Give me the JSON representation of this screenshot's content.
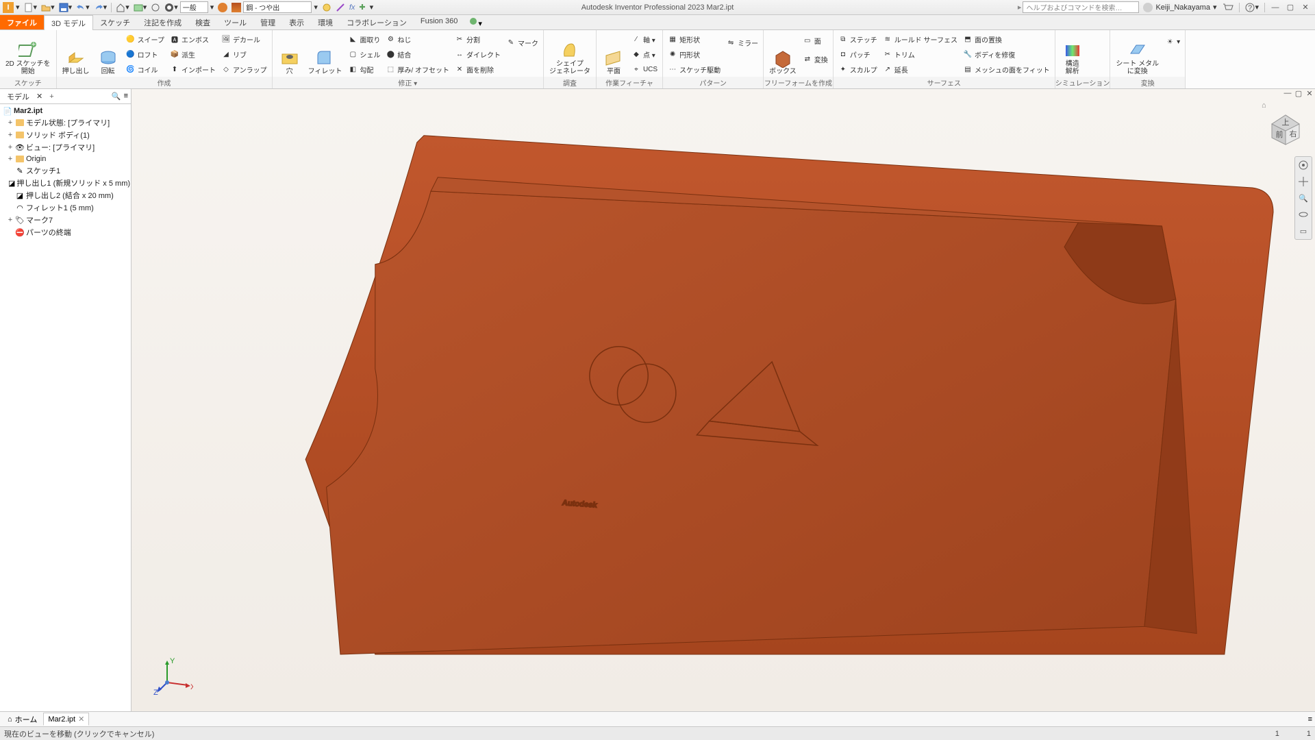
{
  "title": "Autodesk Inventor Professional 2023   Mar2.ipt",
  "search_placeholder": "ヘルプおよびコマンドを検索…",
  "user": "Keiji_Nakayama",
  "qat_generic": "一般",
  "qat_material": "鋼 - つや出",
  "tabs": {
    "file": "ファイル",
    "items": [
      "3D モデル",
      "スケッチ",
      "注記を作成",
      "検査",
      "ツール",
      "管理",
      "表示",
      "環境",
      "コラボレーション",
      "Fusion 360"
    ]
  },
  "ribbon": {
    "sketch": {
      "sketch2d": "2D スケッチを\n開始",
      "label": "スケッチ"
    },
    "create": {
      "extrude": "押し出し",
      "revolve": "回転",
      "sweep": "スイープ",
      "loft": "ロフト",
      "coil": "コイル",
      "emboss": "エンボス",
      "derive": "派生",
      "import": "インポート",
      "rib": "リブ",
      "decal": "デカール",
      "unwrap": "アンラップ",
      "label": "作成"
    },
    "modify": {
      "hole": "穴",
      "fillet": "フィレット",
      "chamfer": "面取り",
      "shell": "シェル",
      "draft": "勾配",
      "split": "分割",
      "combine": "結合",
      "thicken": "厚み/ オフセット",
      "thread": "ねじ",
      "direct": "ダイレクト",
      "deleteface": "面を削除",
      "mark": "マーク",
      "label": "修正 ▾"
    },
    "shape": {
      "gen": "シェイプ\nジェネレータ",
      "label": "調査"
    },
    "workfeat": {
      "plane": "平面",
      "axis": "軸 ▾",
      "point": "点 ▾",
      "ucs": "UCS",
      "label": "作業フィーチャ"
    },
    "pattern": {
      "rect": "矩形状",
      "circ": "円形状",
      "sketchdriven": "スケッチ駆動",
      "label": "パターン",
      "mirror": "ミラー"
    },
    "freeform": {
      "box": "ボックス",
      "face": "面",
      "convert": "変換",
      "label": "フリーフォームを作成"
    },
    "surface": {
      "stitch": "ステッチ",
      "patch": "パッチ",
      "sculpt": "スカルプ",
      "ruled": "ルールド サーフェス",
      "trim": "トリム",
      "extend": "延長",
      "replaceface": "面の置換",
      "bodyrepair": "ボディを修復",
      "fitmesh": "メッシュの面をフィット",
      "label": "サーフェス"
    },
    "sim": {
      "stress": "構造\n解析",
      "label": "シミュレーション"
    },
    "convert": {
      "sheet": "シート メタル\nに変換",
      "label": "変換"
    }
  },
  "browser": {
    "tab": "モデル",
    "root": "Mar2.ipt",
    "nodes": [
      {
        "exp": "+",
        "icon": "folder",
        "lbl": "モデル状態: [プライマリ]"
      },
      {
        "exp": "+",
        "icon": "folder",
        "lbl": "ソリッド ボディ(1)"
      },
      {
        "exp": "+",
        "icon": "view",
        "lbl": "ビュー: [プライマリ]"
      },
      {
        "exp": "+",
        "icon": "folder",
        "lbl": "Origin"
      },
      {
        "exp": "",
        "icon": "sketch",
        "lbl": "スケッチ1"
      },
      {
        "exp": "",
        "icon": "feat",
        "lbl": "押し出し1 (新規ソリッド x 5 mm)"
      },
      {
        "exp": "",
        "icon": "feat",
        "lbl": "押し出し2 (結合 x 20 mm)"
      },
      {
        "exp": "",
        "icon": "fillet",
        "lbl": "フィレット1 (5 mm)"
      },
      {
        "exp": "+",
        "icon": "mark",
        "lbl": "マーク7"
      },
      {
        "exp": "",
        "icon": "end",
        "lbl": "パーツの終端"
      }
    ]
  },
  "doctabs": {
    "home": "ホーム",
    "doc": "Mar2.ipt"
  },
  "status": {
    "hint": "現在のビューを移動 (クリックでキャンセル)",
    "n1": "1",
    "n2": "1"
  },
  "model_text": "Autodesk"
}
